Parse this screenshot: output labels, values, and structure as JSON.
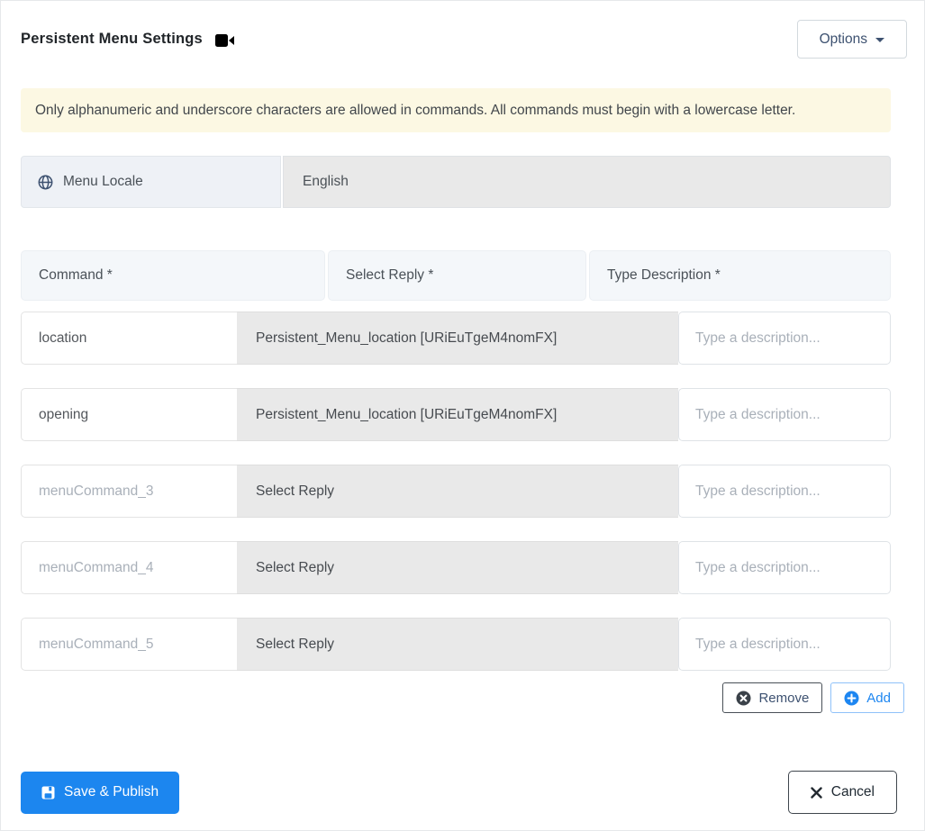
{
  "header": {
    "title": "Persistent Menu Settings",
    "options_label": "Options"
  },
  "alert": {
    "text": "Only alphanumeric and underscore characters are allowed in commands. All commands must begin with a lowercase letter."
  },
  "locale": {
    "label": "Menu Locale",
    "value": "English"
  },
  "table": {
    "headers": [
      "Command *",
      "Select Reply *",
      "Type Description *"
    ],
    "rows": [
      {
        "command": "location",
        "reply": "Persistent_Menu_location [URiEuTgeM4nomFX]",
        "description_placeholder": "Type a description..."
      },
      {
        "command": "opening",
        "reply": "Persistent_Menu_location [URiEuTgeM4nomFX]",
        "description_placeholder": "Type a description..."
      },
      {
        "command": "menuCommand_3",
        "reply": "Select Reply",
        "description_placeholder": "Type a description..."
      },
      {
        "command": "menuCommand_4",
        "reply": "Select Reply",
        "description_placeholder": "Type a description..."
      },
      {
        "command": "menuCommand_5",
        "reply": "Select Reply",
        "description_placeholder": "Type a description..."
      }
    ]
  },
  "actions": {
    "remove_label": "Remove",
    "add_label": "Add"
  },
  "footer": {
    "save_label": "Save & Publish",
    "cancel_label": "Cancel"
  },
  "colors": {
    "primary": "#1c86ef",
    "alert_bg": "#fcf8e3",
    "disabled_bg": "#e9e9e9",
    "table_header_bg": "#f4f7fa",
    "locale_label_bg": "#eef1f6",
    "remove_icon": "#3a4149",
    "add_icon": "#1d86f1"
  }
}
